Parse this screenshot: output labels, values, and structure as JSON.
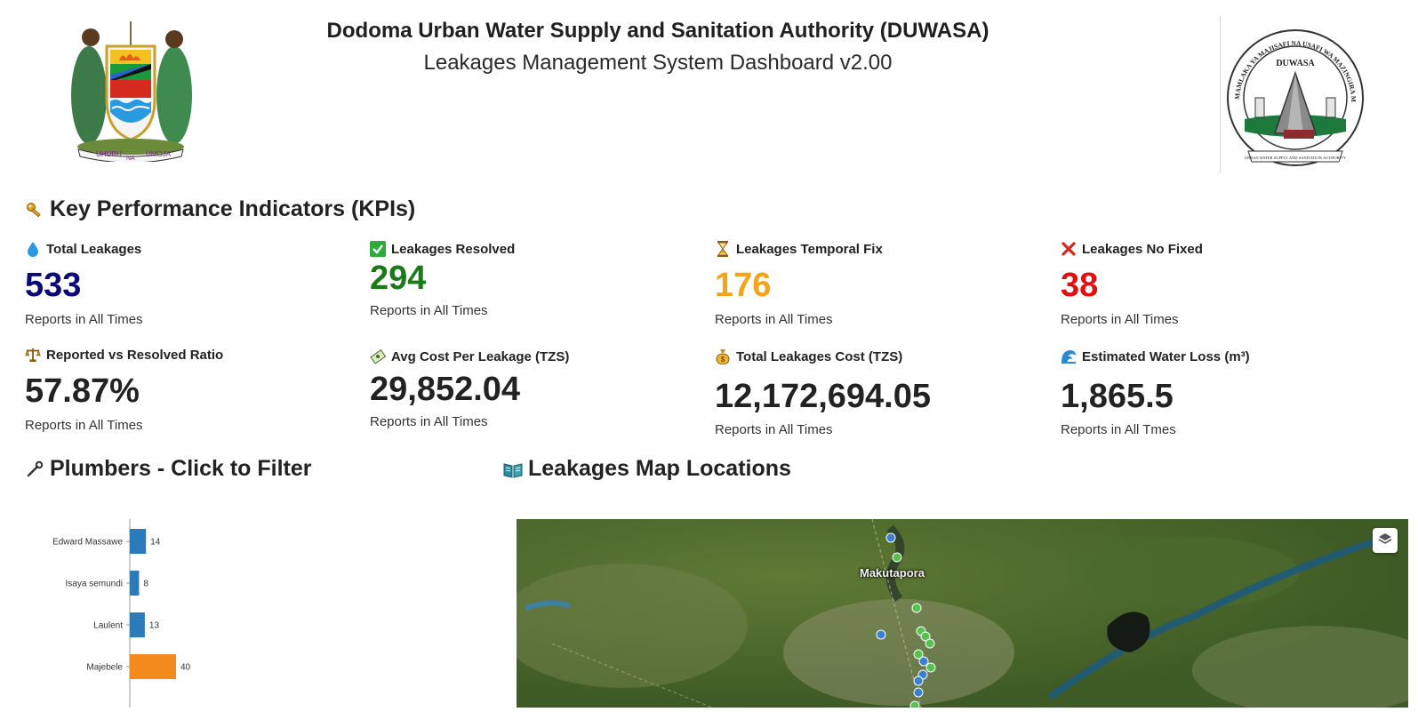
{
  "header": {
    "title": "Dodoma Urban Water Supply and Sanitation Authority (DUWASA)",
    "subtitle": "Leakages Management System Dashboard v2.00",
    "left_emblem": {
      "icon": "tanzania-coat-of-arms-icon",
      "motto_left": "UHURU",
      "motto_mid": "NA",
      "motto_right": "UMOJA"
    },
    "right_logo": {
      "icon": "duwasa-logo-icon",
      "ring_text": "MAMLAKA YA MAJISAFI NA USAFI WA MAZINGIRA MJINI DODOMA",
      "center_text": "DUWASA",
      "ribbon_text": "URBAN WATER SUPPLY AND SANITATION AUTHORITY"
    }
  },
  "kpi_section": {
    "title": "Key Performance Indicators (KPIs)",
    "icon": "key-icon",
    "items": [
      {
        "label": "Total Leakages",
        "value": "533",
        "sub": "Reports in All Times",
        "icon": "water-drop-icon",
        "color": "#0a0a78"
      },
      {
        "label": "Leakages Resolved",
        "value": "294",
        "sub": "Reports in All Times",
        "icon": "check-box-icon",
        "color": "#1a7a16"
      },
      {
        "label": "Leakages Temporal Fix",
        "value": "176",
        "sub": "Reports in All Times",
        "icon": "hourglass-icon",
        "color": "#f5a41a"
      },
      {
        "label": "Leakages No Fixed",
        "value": "38",
        "sub": "Reports in All Times",
        "icon": "cross-mark-icon",
        "color": "#e01010"
      },
      {
        "label": "Reported vs Resolved Ratio",
        "value": "57.87%",
        "sub": "Reports in All Times",
        "icon": "balance-scale-icon",
        "color": "#222222"
      },
      {
        "label": "Avg Cost Per Leakage (TZS)",
        "value": "29,852.04",
        "sub": "Reports in All Times",
        "icon": "money-bill-icon",
        "color": "#222222"
      },
      {
        "label": "Total Leakages Cost (TZS)",
        "value": "12,172,694.05",
        "sub": "Reports in All Times",
        "icon": "money-bag-icon",
        "color": "#222222"
      },
      {
        "label": "Estimated Water Loss  (m³)",
        "value": "1,865.5",
        "sub": "Reports in All Tmes",
        "icon": "water-wave-icon",
        "color": "#222222"
      }
    ]
  },
  "plumbers_section": {
    "title": "Plumbers - Click to Filter",
    "icon": "wrench-icon"
  },
  "map_section": {
    "title": "Leakages Map Locations",
    "icon": "map-book-icon",
    "place_label": "Makutapora",
    "layers_icon": "layers-icon"
  },
  "chart_data": {
    "type": "bar",
    "orientation": "horizontal",
    "categories": [
      "Edward Massawe",
      "Isaya semundi",
      "Laulent",
      "Majebele"
    ],
    "values": [
      14,
      8,
      13,
      40
    ],
    "colors": [
      "#2b7bba",
      "#2b7bba",
      "#2b7bba",
      "#f28a1e"
    ],
    "xlim": [
      0,
      100
    ],
    "data_labels": true
  }
}
